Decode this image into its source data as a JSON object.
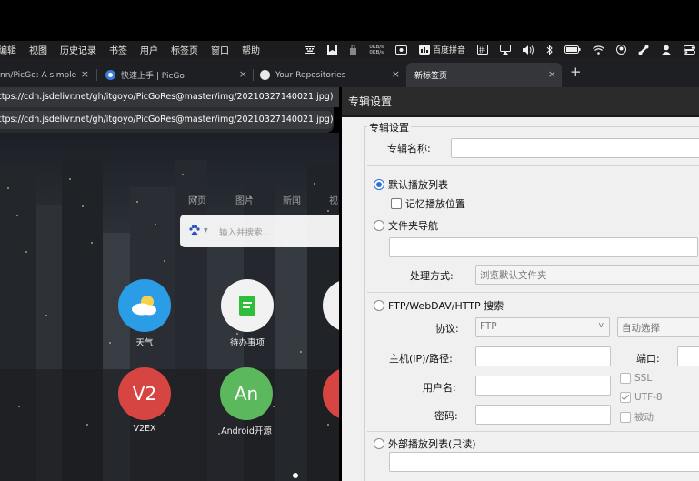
{
  "menubar": {
    "menus": [
      "编辑",
      "视图",
      "历史记录",
      "书签",
      "用户",
      "标签页",
      "窗口",
      "帮助"
    ],
    "netspeed_up": "0KB/s",
    "netspeed_down": "0KB/s",
    "ime_label": "百度拼音"
  },
  "tabs": [
    {
      "title": "nn/PicGo: A simple &",
      "favicon": "github-icon",
      "active": false
    },
    {
      "title": "快速上手 | PicGo",
      "favicon": "picgo-icon",
      "active": false
    },
    {
      "title": "Your Repositories",
      "favicon": "github-icon",
      "active": false
    },
    {
      "title": "新标签页",
      "favicon": "",
      "active": true
    }
  ],
  "tab_close_glyph": "×",
  "new_tab_glyph": "+",
  "urlbar": {
    "value": "ttps://cdn.jsdelivr.net/gh/itgoyo/PicGoRes@master/img/20210327140021.jpg)",
    "suggestion": "ttps://cdn.jsdelivr.net/gh/itgoyo/PicGoRes@master/img/20210327140021.jpg)"
  },
  "newtab": {
    "search_nav": [
      "网页",
      "图片",
      "新闻",
      "视"
    ],
    "search_placeholder": "输入并搜索...",
    "apps": [
      {
        "label": "天气",
        "icon": "weather-icon",
        "text": "",
        "color": "#2a9de6"
      },
      {
        "label": "待办事项",
        "icon": "todo-icon",
        "text": "",
        "color": "#f2f2f2"
      },
      {
        "label": "V2EX",
        "icon": "v2ex-icon",
        "text": "V2",
        "color": "#d64541"
      },
      {
        "label": "Android开源",
        "icon": "android-icon",
        "text": "An",
        "color": "#5cb85c"
      }
    ]
  },
  "dialog": {
    "title": "专辑设置",
    "group_label": "专辑设置",
    "album_name_label": "专辑名称:",
    "album_name_value": "",
    "radio_default_playlist": "默认播放列表",
    "check_remember_position": "记忆播放位置",
    "radio_folder_nav": "文件夹导航",
    "folder_path_value": "",
    "handling_label": "处理方式:",
    "handling_value": "浏览默认文件夹",
    "radio_ftp": "FTP/WebDAV/HTTP 搜索",
    "protocol_label": "协议:",
    "protocol_value": "FTP",
    "protocol_arrow": "v",
    "encoding_value": "自动选择",
    "host_label": "主机(IP)/路径:",
    "port_label": "端口:",
    "ssl_label": "SSL",
    "username_label": "用户名:",
    "utf8_label": "UTF-8",
    "password_label": "密码:",
    "passive_label": "被动",
    "radio_external": "外部播放列表(只读)"
  }
}
